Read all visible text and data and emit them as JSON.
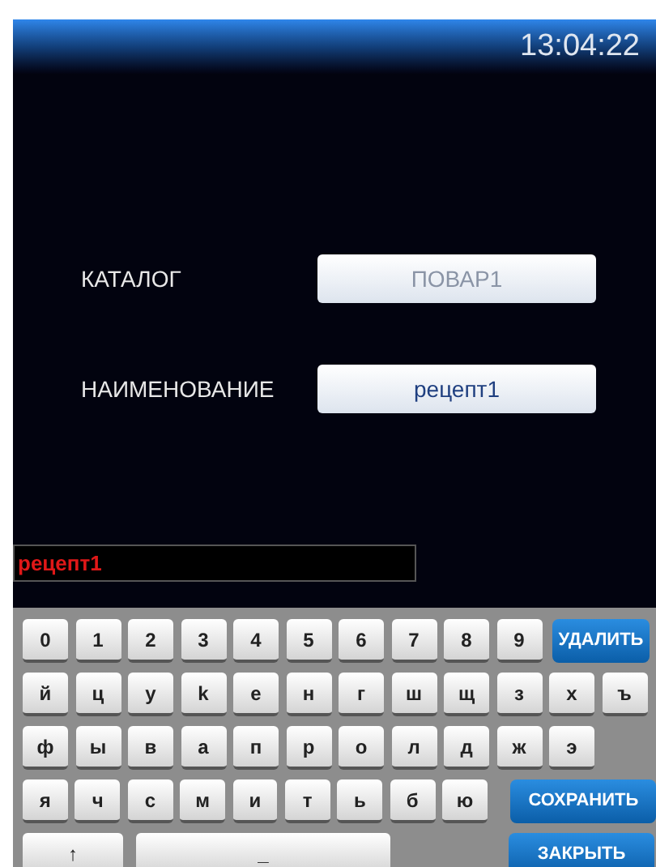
{
  "status_bar": {
    "time": "13:04:22"
  },
  "form": [
    {
      "label": "КАТАЛОГ",
      "value": "ПОВАР1",
      "disabled": true
    },
    {
      "label": "НАИМЕНОВАНИЕ",
      "value": "рецепт1",
      "disabled": false
    }
  ],
  "entry": {
    "value": "рецепт1"
  },
  "keyboard": {
    "rows": [
      {
        "keys": [
          "0",
          "1",
          "2",
          "3",
          "4",
          "5",
          "6",
          "7",
          "8",
          "9"
        ],
        "action": "УДАЛИТЬ"
      },
      {
        "keys": [
          "й",
          "ц",
          "у",
          "k",
          "е",
          "н",
          "г",
          "ш",
          "щ",
          "з",
          "х",
          "ъ"
        ]
      },
      {
        "keys": [
          "ф",
          "ы",
          "в",
          "а",
          "п",
          "р",
          "о",
          "л",
          "д",
          "ж",
          "э"
        ]
      },
      {
        "keys": [
          "я",
          "ч",
          "с",
          "м",
          "и",
          "т",
          "ь",
          "б",
          "ю"
        ],
        "action": "СОХРАНИТЬ"
      }
    ],
    "bottom": {
      "shift": "↑",
      "space": "_",
      "action": "ЗАКРЫТЬ"
    }
  }
}
